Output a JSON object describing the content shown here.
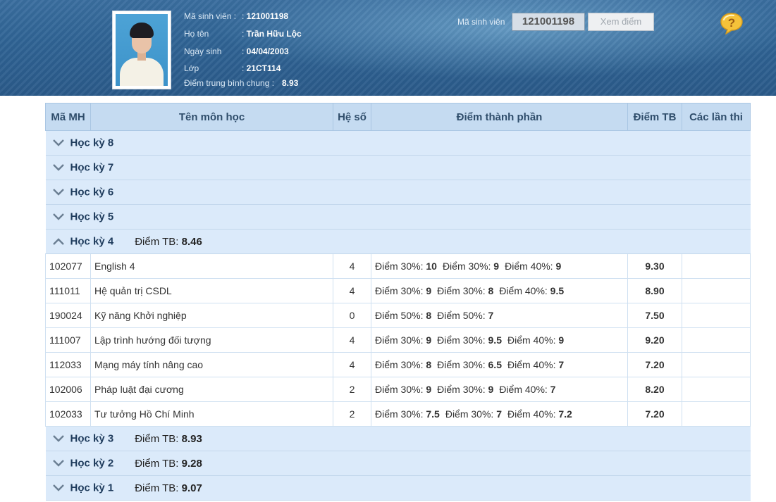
{
  "student": {
    "id_label": "Mã sinh viên :",
    "id": "121001198",
    "name_label": "Họ tên",
    "name": "Trần Hữu Lộc",
    "dob_label": "Ngày sinh",
    "dob": "04/04/2003",
    "class_label": "Lớp",
    "class": "21CT114",
    "avg_label": "Điểm trung bình chung :",
    "avg": "8.93"
  },
  "search": {
    "label": "Mã sinh viên",
    "value": "121001198",
    "button": "Xem điểm"
  },
  "help_icon": "help-question-icon",
  "table": {
    "headers": [
      "Mã MH",
      "Tên môn học",
      "Hệ số",
      "Điểm thành phần",
      "Điểm TB",
      "Các lần thi"
    ],
    "avg_prefix": "Điểm TB:",
    "collapsed_top": [
      {
        "label": "Học kỳ 8"
      },
      {
        "label": "Học kỳ 7"
      },
      {
        "label": "Học kỳ 6"
      },
      {
        "label": "Học kỳ 5"
      }
    ],
    "expanded": {
      "label": "Học kỳ 4",
      "avg": "8.46",
      "subjects": [
        {
          "code": "102077",
          "name": "English 4",
          "coef": "4",
          "parts": [
            {
              "label": "Điểm 30%:",
              "value": "10"
            },
            {
              "label": "Điểm 30%:",
              "value": "9"
            },
            {
              "label": "Điểm 40%:",
              "value": "9"
            }
          ],
          "avg": "9.30",
          "attempts": ""
        },
        {
          "code": "111011",
          "name": "Hệ quản trị CSDL",
          "coef": "4",
          "parts": [
            {
              "label": "Điểm 30%:",
              "value": "9"
            },
            {
              "label": "Điểm 30%:",
              "value": "8"
            },
            {
              "label": "Điểm 40%:",
              "value": "9.5"
            }
          ],
          "avg": "8.90",
          "attempts": ""
        },
        {
          "code": "190024",
          "name": "Kỹ năng Khởi nghiệp",
          "coef": "0",
          "parts": [
            {
              "label": "Điểm 50%:",
              "value": "8"
            },
            {
              "label": "Điểm 50%:",
              "value": "7"
            }
          ],
          "avg": "7.50",
          "attempts": ""
        },
        {
          "code": "111007",
          "name": "Lập trình hướng đối tượng",
          "coef": "4",
          "parts": [
            {
              "label": "Điểm 30%:",
              "value": "9"
            },
            {
              "label": "Điểm 30%:",
              "value": "9.5"
            },
            {
              "label": "Điểm 40%:",
              "value": "9"
            }
          ],
          "avg": "9.20",
          "attempts": ""
        },
        {
          "code": "112033",
          "name": "Mạng máy tính nâng cao",
          "coef": "4",
          "parts": [
            {
              "label": "Điểm 30%:",
              "value": "8"
            },
            {
              "label": "Điểm 30%:",
              "value": "6.5"
            },
            {
              "label": "Điểm 40%:",
              "value": "7"
            }
          ],
          "avg": "7.20",
          "attempts": ""
        },
        {
          "code": "102006",
          "name": "Pháp luật đại cương",
          "coef": "2",
          "parts": [
            {
              "label": "Điểm 30%:",
              "value": "9"
            },
            {
              "label": "Điểm 30%:",
              "value": "9"
            },
            {
              "label": "Điểm 40%:",
              "value": "7"
            }
          ],
          "avg": "8.20",
          "attempts": ""
        },
        {
          "code": "102033",
          "name": "Tư tưởng Hồ Chí Minh",
          "coef": "2",
          "parts": [
            {
              "label": "Điểm 30%:",
              "value": "7.5"
            },
            {
              "label": "Điểm 30%:",
              "value": "7"
            },
            {
              "label": "Điểm 40%:",
              "value": "7.2"
            }
          ],
          "avg": "7.20",
          "attempts": ""
        }
      ]
    },
    "collapsed_bottom": [
      {
        "label": "Học kỳ 3",
        "avg": "8.93"
      },
      {
        "label": "Học kỳ 2",
        "avg": "9.28"
      },
      {
        "label": "Học kỳ 1",
        "avg": "9.07"
      }
    ]
  }
}
